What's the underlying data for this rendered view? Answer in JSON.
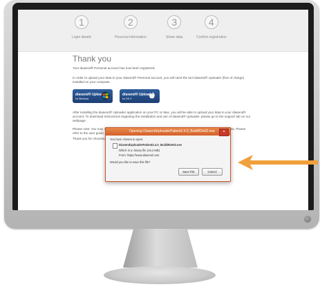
{
  "steps": [
    {
      "number": "1",
      "label": "Login details"
    },
    {
      "number": "2",
      "label": "Personal information"
    },
    {
      "number": "3",
      "label": "Share data"
    },
    {
      "number": "4",
      "label": "Confirm registration"
    }
  ],
  "page": {
    "title": "Thank you",
    "registered_text": "Your diasend® Personal account has now been registered.",
    "upload_text": "In order to upload your data to your diasend® Personal account, you will need the tool diasend® Uploader (free of charge) installed on your computer.",
    "after_install_text": "After installing the diasend® Uploader application on your PC or Mac, you will be able to upload your data to your diasend® account. To download instructions regarding the installation and use of diasend® Uploader, please go to the support tab on our webpage.",
    "note_text": "Please note: You may need to be logged in on your computer as an administrator to install diasend® Uploader data. Please refer to the user guide...",
    "thank_you_text": "Thank you for choosing diasend®"
  },
  "download_buttons": [
    {
      "title": "diasend® Uploader",
      "subtitle": "for Windows",
      "icon": "windows-logo-icon"
    },
    {
      "title": "diasend® Uploader",
      "subtitle": "for OS X",
      "icon": "apple-logo-icon"
    }
  ],
  "dialog": {
    "title": "Opening DiasendUploaderPatient2.4.0_BuildR2e02.exe",
    "close_label": "×",
    "intro": "You have chosen to open:",
    "filename": "DiasendUploaderPatient2.4.0_BuildR2e02.exe",
    "which_is": "Which is a: binary file (16,2 MB)",
    "from": "From: https://www.diasend.com",
    "question": "Would you like to save this file?",
    "save_label": "Save File",
    "cancel_label": "Cancel"
  },
  "colors": {
    "arrow": "#f0a03c",
    "dialog_title": "#e07a3a",
    "button_blue": "#2f5f9e"
  }
}
